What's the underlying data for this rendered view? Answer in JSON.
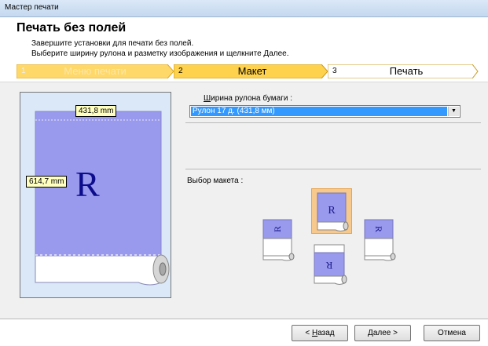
{
  "window": {
    "title": "Мастер печати"
  },
  "header": {
    "title": "Печать без полей",
    "line1": "Завершите установки для печати без полей.",
    "line2": "Выберите ширину рулона и разметку изображения и щелкните Далее."
  },
  "steps": [
    {
      "num": "1",
      "label": "Меню печати",
      "state": "done"
    },
    {
      "num": "2",
      "label": "Макет",
      "state": "current"
    },
    {
      "num": "3",
      "label": "Печать",
      "state": "pending"
    }
  ],
  "preview": {
    "width_label": "431,8 mm",
    "height_label": "614,7 mm",
    "glyph": "R"
  },
  "paper": {
    "label_accel": "Ш",
    "label_rest": "ирина рулона бумаги :",
    "value": "Рулон 17 д. (431,8 мм)"
  },
  "layout": {
    "label": "Выбор макета :",
    "options": [
      {
        "orientation": "top",
        "glyph": "R",
        "selected": true
      },
      {
        "orientation": "left",
        "glyph": "R",
        "selected": false
      },
      {
        "orientation": "right",
        "glyph": "R",
        "selected": false
      },
      {
        "orientation": "bottom",
        "glyph": "R",
        "selected": false
      }
    ]
  },
  "buttons": {
    "back_prefix": "< ",
    "back_accel": "Н",
    "back_rest": "азад",
    "next_accel": "Д",
    "next_rest": "алее >",
    "cancel": "Отмена"
  },
  "colors": {
    "accent": "#ffd24d",
    "paper": "#9999ee",
    "selection": "#3399ff"
  }
}
